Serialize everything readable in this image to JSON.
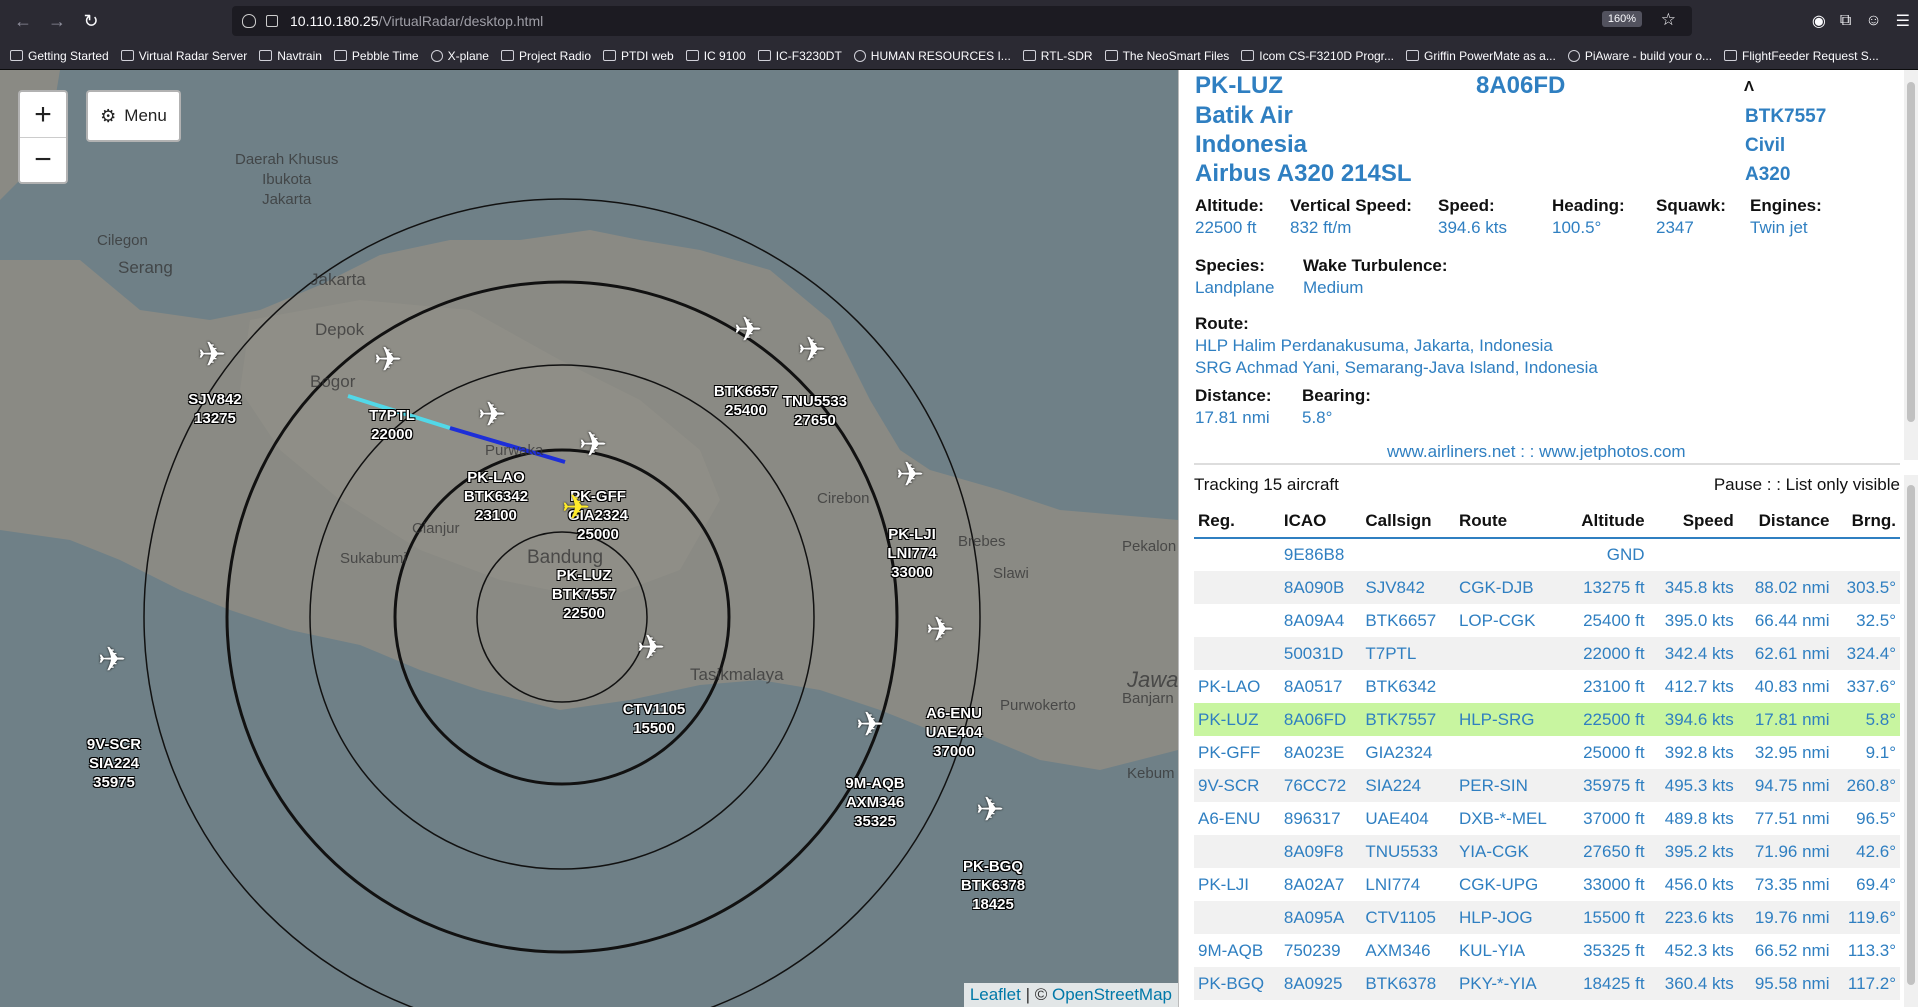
{
  "browser": {
    "url_host": "10.110.180.25",
    "url_path": "/VirtualRadar/desktop.html",
    "zoom": "160%",
    "bookmarks": [
      "Getting Started",
      "Virtual Radar Server",
      "Navtrain",
      "Pebble Time",
      "X-plane",
      "Project Radio",
      "PTDI web",
      "IC 9100",
      "IC-F3230DT",
      "HUMAN RESOURCES I...",
      "RTL-SDR",
      "The NeoSmart Files",
      "Icom CS-F3210D Progr...",
      "Griffin PowerMate as a...",
      "PiAware - build your o...",
      "FlightFeeder Request S..."
    ]
  },
  "map": {
    "menu_label": "Menu",
    "zoom_in": "+",
    "zoom_out": "−",
    "attribution_leaflet": "Leaflet",
    "attribution_sep": " | © ",
    "attribution_osm": "OpenStreetMap",
    "places": [
      "Daerah Khusus",
      "Ibukota",
      "Jakarta",
      "Cilegon",
      "Serang",
      "Jakarta",
      "Depok",
      "Bogor",
      "Sukabumi",
      "Cianjur",
      "Bandung",
      "Tasikmalaya",
      "Cirebon",
      "Brebes",
      "Slawi",
      "Pekalon",
      "Jawa",
      "Banjarn",
      "Purwokerto",
      "Kebum",
      "Purwaka"
    ],
    "aircraft": [
      {
        "label": [
          "SJV842",
          "13275"
        ]
      },
      {
        "label": [
          "T7PTL",
          "22000"
        ]
      },
      {
        "label": [
          "PK-LAO",
          "BTK6342",
          "23100"
        ]
      },
      {
        "label": [
          "PK-GFF",
          "GIA2324",
          "25000"
        ]
      },
      {
        "label": [
          "PK-LUZ",
          "BTK7557",
          "22500"
        ]
      },
      {
        "label": [
          "BTK6657",
          "25400"
        ]
      },
      {
        "label": [
          "TNU5533",
          "27650"
        ]
      },
      {
        "label": [
          "PK-LJI",
          "LNI774",
          "33000"
        ]
      },
      {
        "label": [
          "CTV1105",
          "15500"
        ]
      },
      {
        "label": [
          "A6-ENU",
          "UAE404",
          "37000"
        ]
      },
      {
        "label": [
          "9M-AQB",
          "AXM346",
          "35325"
        ]
      },
      {
        "label": [
          "PK-BGQ",
          "BTK6378",
          "18425"
        ]
      },
      {
        "label": [
          "9V-SCR",
          "SIA224",
          "35975"
        ]
      }
    ]
  },
  "detail": {
    "reg": "PK-LUZ",
    "icao": "8A06FD",
    "operator_line1": "Batik Air",
    "operator_line2": "Indonesia",
    "model": "Airbus A320 214SL",
    "callsign": "BTK7557",
    "type": "Civil",
    "icao_type": "A320",
    "altitude_label": "Altitude:",
    "altitude": "22500 ft",
    "vs_label": "Vertical Speed:",
    "vs": "832 ft/m",
    "speed_label": "Speed:",
    "speed": "394.6 kts",
    "heading_label": "Heading:",
    "heading": "100.5°",
    "squawk_label": "Squawk:",
    "squawk": "2347",
    "engines_label": "Engines:",
    "engines": "Twin jet",
    "species_label": "Species:",
    "species": "Landplane",
    "wake_label": "Wake Turbulence:",
    "wake": "Medium",
    "route_label": "Route:",
    "route_from": "HLP Halim Perdanakusuma, Jakarta, Indonesia",
    "route_to": "SRG Achmad Yani, Semarang-Java Island, Indonesia",
    "distance_label": "Distance:",
    "distance": "17.81 nmi",
    "bearing_label": "Bearing:",
    "bearing": "5.8°",
    "links": "www.airliners.net : : www.jetphotos.com"
  },
  "list": {
    "tracking": "Tracking 15 aircraft",
    "controls": "Pause : : List only visible",
    "columns": [
      "Reg.",
      "ICAO",
      "Callsign",
      "Route",
      "Altitude",
      "Speed",
      "Distance",
      "Brng."
    ],
    "rows": [
      [
        "",
        "9E86B8",
        "",
        "",
        "GND",
        "",
        "",
        ""
      ],
      [
        "",
        "8A090B",
        "SJV842",
        "CGK-DJB",
        "13275 ft",
        "345.8 kts",
        "88.02 nmi",
        "303.5°"
      ],
      [
        "",
        "8A09A4",
        "BTK6657",
        "LOP-CGK",
        "25400 ft",
        "395.0 kts",
        "66.44 nmi",
        "32.5°"
      ],
      [
        "",
        "50031D",
        "T7PTL",
        "",
        "22000 ft",
        "342.4 kts",
        "62.61 nmi",
        "324.4°"
      ],
      [
        "PK-LAO",
        "8A0517",
        "BTK6342",
        "",
        "23100 ft",
        "412.7 kts",
        "40.83 nmi",
        "337.6°"
      ],
      [
        "PK-LUZ",
        "8A06FD",
        "BTK7557",
        "HLP-SRG",
        "22500 ft",
        "394.6 kts",
        "17.81 nmi",
        "5.8°"
      ],
      [
        "PK-GFF",
        "8A023E",
        "GIA2324",
        "",
        "25000 ft",
        "392.8 kts",
        "32.95 nmi",
        "9.1°"
      ],
      [
        "9V-SCR",
        "76CC72",
        "SIA224",
        "PER-SIN",
        "35975 ft",
        "495.3 kts",
        "94.75 nmi",
        "260.8°"
      ],
      [
        "A6-ENU",
        "896317",
        "UAE404",
        "DXB-*-MEL",
        "37000 ft",
        "489.8 kts",
        "77.51 nmi",
        "96.5°"
      ],
      [
        "",
        "8A09F8",
        "TNU5533",
        "YIA-CGK",
        "27650 ft",
        "395.2 kts",
        "71.96 nmi",
        "42.6°"
      ],
      [
        "PK-LJI",
        "8A02A7",
        "LNI774",
        "CGK-UPG",
        "33000 ft",
        "456.0 kts",
        "73.35 nmi",
        "69.4°"
      ],
      [
        "",
        "8A095A",
        "CTV1105",
        "HLP-JOG",
        "15500 ft",
        "223.6 kts",
        "19.76 nmi",
        "119.6°"
      ],
      [
        "9M-AQB",
        "750239",
        "AXM346",
        "KUL-YIA",
        "35325 ft",
        "452.3 kts",
        "66.52 nmi",
        "113.3°"
      ],
      [
        "PK-BGQ",
        "8A0925",
        "BTK6378",
        "PKY-*-YIA",
        "18425 ft",
        "360.4 kts",
        "95.58 nmi",
        "117.2°"
      ]
    ],
    "selected_index": 5
  }
}
